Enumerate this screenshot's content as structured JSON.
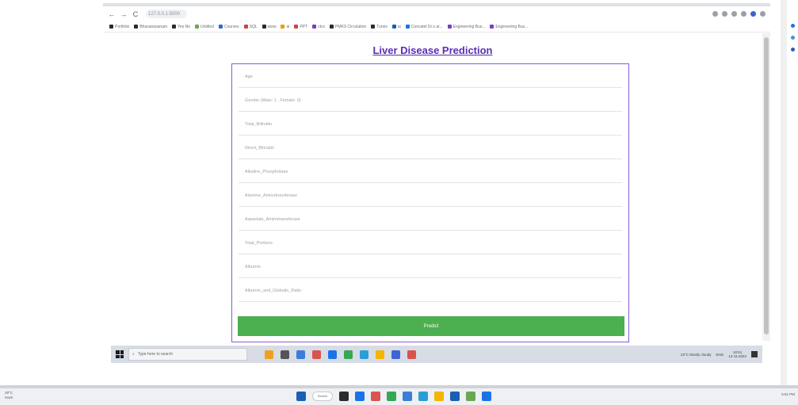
{
  "browser": {
    "url": "127.0.0.1:5000",
    "nav_back": "←",
    "nav_forward": "→",
    "nav_reload": "C",
    "bookmarks": [
      {
        "label": "Portfolio",
        "color": "#2b2b2b"
      },
      {
        "label": "Bhavanasanam",
        "color": "#2b2b2b"
      },
      {
        "label": "Yes No",
        "color": "#2b2b2b"
      },
      {
        "label": "Untitled",
        "color": "#6aa84f"
      },
      {
        "label": "Courses",
        "color": "#3366cc"
      },
      {
        "label": "SQL",
        "color": "#cc4444"
      },
      {
        "label": "www",
        "color": "#2b2b2b"
      },
      {
        "label": "ai",
        "color": "#e6a100"
      },
      {
        "label": "PPT",
        "color": "#cc4444"
      },
      {
        "label": "ctcs",
        "color": "#7b3fc4"
      },
      {
        "label": "PMKS Circulation",
        "color": "#2b2b2b"
      },
      {
        "label": "Tunes",
        "color": "#2b2b2b"
      },
      {
        "label": "ai",
        "color": "#1a5fb4"
      },
      {
        "label": "Concatel Dr.s ar...",
        "color": "#1a73e8"
      },
      {
        "label": "Engineering Bus...",
        "color": "#7b3fc4"
      },
      {
        "label": "Engineering Bus...",
        "color": "#7b3fc4"
      }
    ]
  },
  "page": {
    "title": "Liver Disease Prediction",
    "fields": [
      {
        "name": "age-field",
        "placeholder": "Age"
      },
      {
        "name": "gender-field",
        "placeholder": "Gender (Male: 1 , Female: 0)"
      },
      {
        "name": "total-bilirubin-field",
        "placeholder": "Total_Bilirubin"
      },
      {
        "name": "direct-bilirubin-field",
        "placeholder": "Direct_Bilirubin"
      },
      {
        "name": "alkaline-phosphotase-field",
        "placeholder": "Alkaline_Phosphotase"
      },
      {
        "name": "alamine-aminotransferase-field",
        "placeholder": "Alamine_Aminotransferase"
      },
      {
        "name": "aspartate-aminotransferase-field",
        "placeholder": "Aspartate_Aminotransferase"
      },
      {
        "name": "total-proteins-field",
        "placeholder": "Total_Protiens"
      },
      {
        "name": "albumin-field",
        "placeholder": "Albumin"
      },
      {
        "name": "albumin-globulin-ratio-field",
        "placeholder": "Albumin_and_Globulin_Ratio"
      }
    ],
    "predict_label": "Predict",
    "colors": {
      "title": "#5b2db3",
      "border": "#8a5bd1",
      "button": "#4caf50"
    }
  },
  "inner_taskbar": {
    "search_placeholder": "Type here to search",
    "weather": "23°C  Mostly cloudy",
    "lang": "ENG",
    "time": "10:51",
    "date": "14-11-2022",
    "apps": [
      "#f0a020",
      "#555555",
      "#3c7dd9",
      "#d9534f",
      "#1a73e8",
      "#34a853",
      "#2a9fd6",
      "#f4b400",
      "#3c64d6",
      "#d9534f"
    ]
  },
  "outer_taskbar": {
    "weather": "29°C\nHaze",
    "search_label": "Search",
    "time": "5:51 PM",
    "apps": [
      "#1a5fb4",
      "#2b2b2b",
      "#1a73e8",
      "#d9534f",
      "#34a853",
      "#3c7dd9",
      "#2a9fd6",
      "#f4b400",
      "#1a5fb4",
      "#6aa84f",
      "#1a73e8"
    ]
  }
}
